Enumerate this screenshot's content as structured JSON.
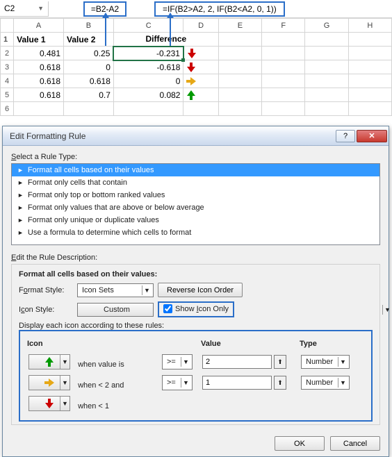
{
  "nameBox": "C2",
  "formula1": "=B2-A2",
  "formula2": "=IF(B2>A2, 2, IF(B2<A2, 0, 1))",
  "columns": [
    "A",
    "B",
    "C",
    "D",
    "E",
    "F",
    "G",
    "H"
  ],
  "headers": {
    "a": "Value 1",
    "b": "Value 2",
    "c": "Difference"
  },
  "rows": [
    {
      "r": "2",
      "a": "0.481",
      "b": "0.25",
      "c": "-0.231",
      "icon": "down"
    },
    {
      "r": "3",
      "a": "0.618",
      "b": "0",
      "c": "-0.618",
      "icon": "down"
    },
    {
      "r": "4",
      "a": "0.618",
      "b": "0.618",
      "c": "0",
      "icon": "right"
    },
    {
      "r": "5",
      "a": "0.618",
      "b": "0.7",
      "c": "0.082",
      "icon": "up"
    }
  ],
  "dialog": {
    "title": "Edit Formatting Rule",
    "helpGlyph": "?",
    "closeGlyph": "✕",
    "selectRuleLabel": "Select a Rule Type:",
    "ruleTypes": [
      "Format all cells based on their values",
      "Format only cells that contain",
      "Format only top or bottom ranked values",
      "Format only values that are above or below average",
      "Format only unique or duplicate values",
      "Use a formula to determine which cells to format"
    ],
    "editDescLabel": "Edit the Rule Description:",
    "frameTitle": "Format all cells based on their values:",
    "formatStyleLabel": "Format Style:",
    "formatStyleValue": "Icon Sets",
    "reverseBtn": "Reverse Icon Order",
    "iconStyleLabel": "Icon Style:",
    "iconStyleValue": "Custom",
    "showIconOnly": "Show Icon Only",
    "displayRulesLabel": "Display each icon according to these rules:",
    "cols": {
      "icon": "Icon",
      "value": "Value",
      "type": "Type"
    },
    "rules": [
      {
        "icon": "up",
        "text": "when value is",
        "op": ">=",
        "val": "2",
        "type": "Number"
      },
      {
        "icon": "right",
        "text": "when < 2 and",
        "op": ">=",
        "val": "1",
        "type": "Number"
      },
      {
        "icon": "down",
        "text": "when < 1"
      }
    ],
    "ok": "OK",
    "cancel": "Cancel"
  }
}
